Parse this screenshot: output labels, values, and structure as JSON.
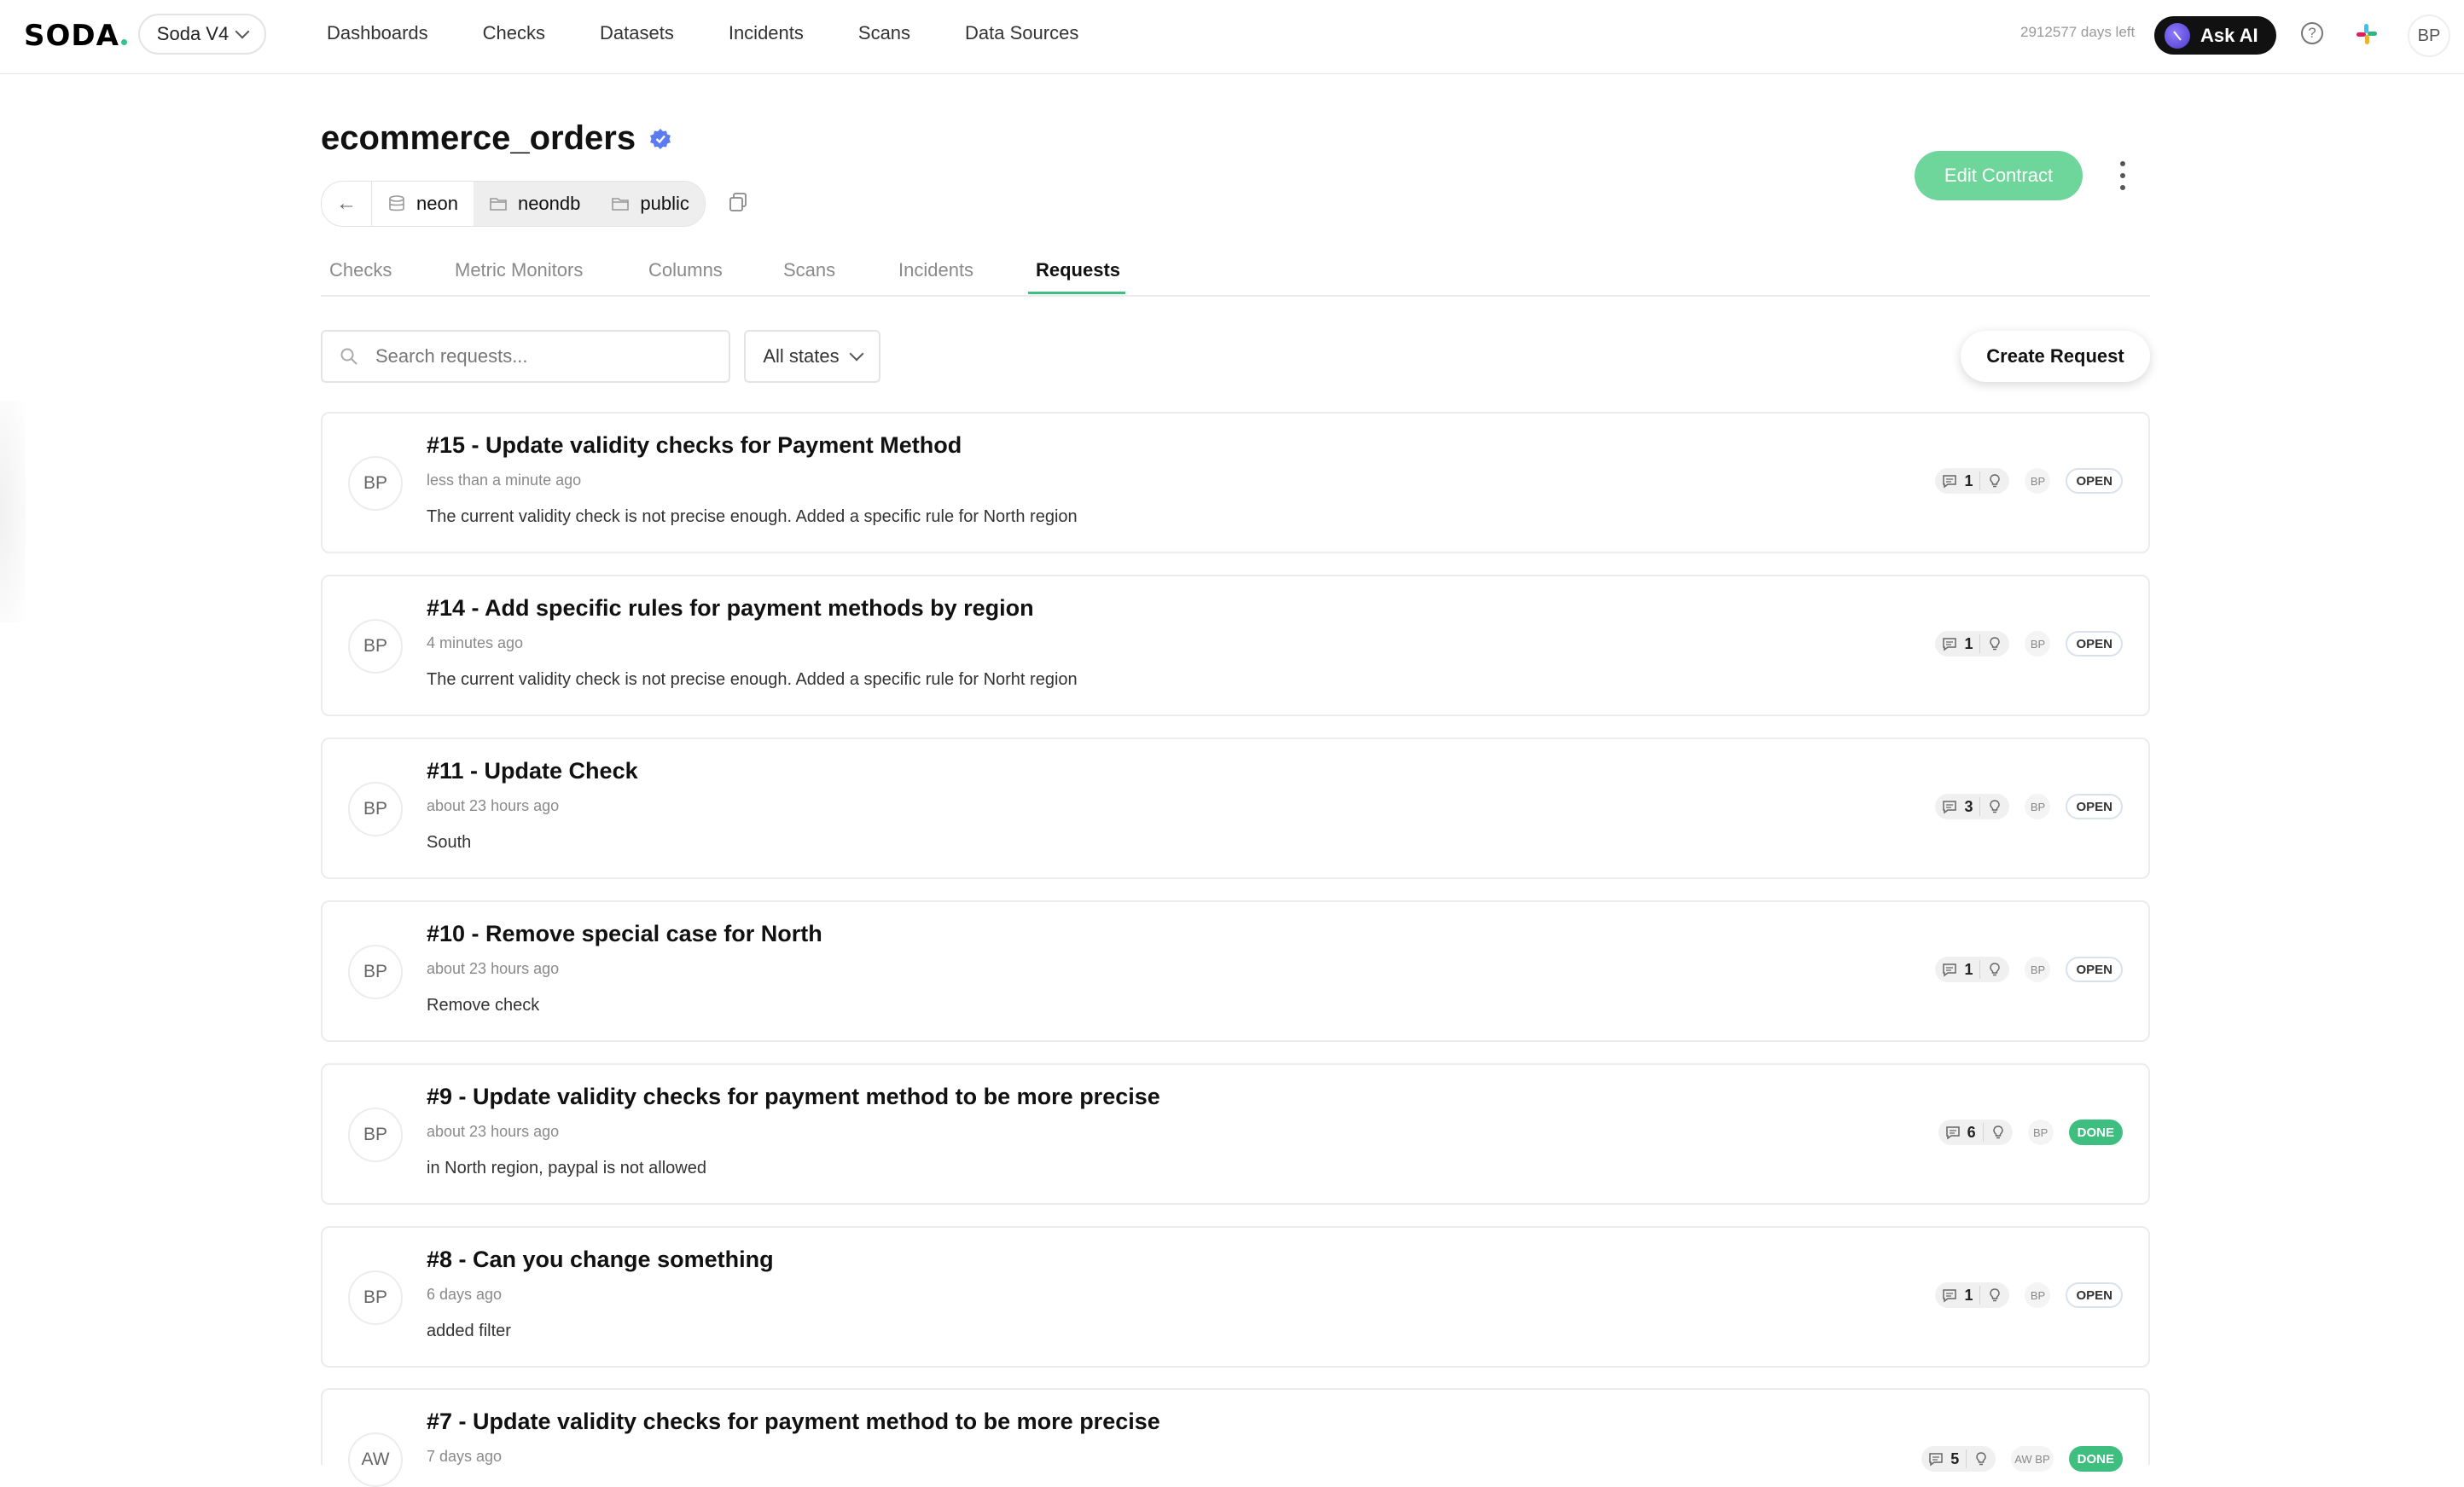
{
  "topbar": {
    "logo": "SODA",
    "workspace": "Soda V4",
    "nav": [
      "Dashboards",
      "Checks",
      "Datasets",
      "Incidents",
      "Scans",
      "Data Sources"
    ],
    "trial_text": "2912577 days left",
    "ask_ai_label": "Ask AI",
    "user_initials": "BP"
  },
  "dataset": {
    "title": "ecommerce_orders",
    "breadcrumbs": [
      "neon",
      "neondb",
      "public"
    ],
    "edit_contract_label": "Edit Contract"
  },
  "tabs": [
    "Checks",
    "Metric Monitors",
    "Columns",
    "Scans",
    "Incidents",
    "Requests"
  ],
  "active_tab": "Requests",
  "toolbar": {
    "search_placeholder": "Search requests...",
    "states_label": "All states",
    "create_label": "Create Request"
  },
  "colors": {
    "accent_green": "#3fbf7f",
    "edit_button": "#6fd69b",
    "verified_blue": "#5b7cf0"
  },
  "requests": [
    {
      "avatar": "BP",
      "title": "#15 - Update validity checks for Payment Method",
      "time": "less than a minute ago",
      "desc": "The current validity check is not precise enough. Added a specific rule for North region",
      "comments": "1",
      "participants": "BP",
      "status": "OPEN"
    },
    {
      "avatar": "BP",
      "title": "#14 - Add specific rules for payment methods by region",
      "time": "4 minutes ago",
      "desc": "The current validity check is not precise enough. Added a specific rule for Norht region",
      "comments": "1",
      "participants": "BP",
      "status": "OPEN"
    },
    {
      "avatar": "BP",
      "title": "#11 - Update Check",
      "time": "about 23 hours ago",
      "desc": "South",
      "comments": "3",
      "participants": "BP",
      "status": "OPEN"
    },
    {
      "avatar": "BP",
      "title": "#10 - Remove special case for North",
      "time": "about 23 hours ago",
      "desc": "Remove check",
      "comments": "1",
      "participants": "BP",
      "status": "OPEN"
    },
    {
      "avatar": "BP",
      "title": "#9 - Update validity checks for payment method to be more precise",
      "time": "about 23 hours ago",
      "desc": "in North region, paypal is not allowed",
      "comments": "6",
      "participants": "BP",
      "status": "DONE"
    },
    {
      "avatar": "BP",
      "title": "#8 - Can you change something",
      "time": "6 days ago",
      "desc": "added filter",
      "comments": "1",
      "participants": "BP",
      "status": "OPEN"
    },
    {
      "avatar": "AW",
      "title": "#7 - Update validity checks for payment method to be more precise",
      "time": "7 days ago",
      "desc": "",
      "comments": "5",
      "participants": "AW BP",
      "status": "DONE"
    }
  ]
}
